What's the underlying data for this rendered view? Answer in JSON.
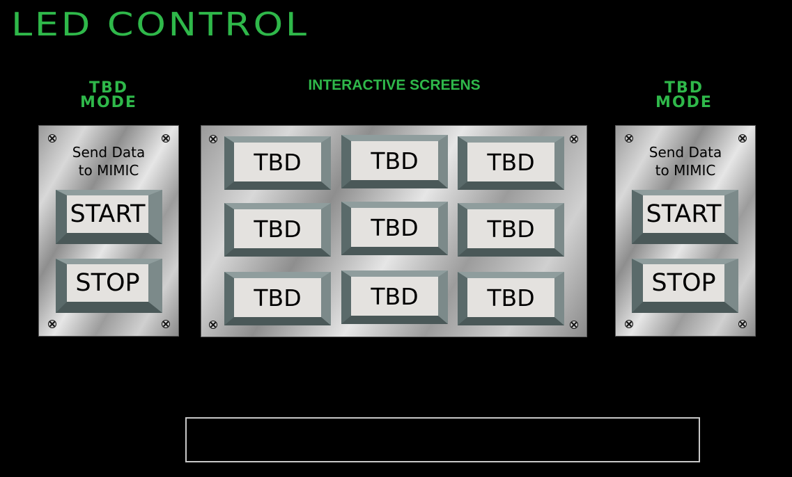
{
  "header": {
    "title": "LED CONTROL"
  },
  "left_panel": {
    "mode_label_line1": "TBD",
    "mode_label_line2": "MODE",
    "send_text_line1": "Send Data",
    "send_text_line2": "to MIMIC",
    "start_label": "START",
    "stop_label": "STOP"
  },
  "center_panel": {
    "label": "INTERACTIVE SCREENS",
    "buttons": [
      "TBD",
      "TBD",
      "TBD",
      "TBD",
      "TBD",
      "TBD",
      "TBD",
      "TBD",
      "TBD"
    ]
  },
  "right_panel": {
    "mode_label_line1": "TBD",
    "mode_label_line2": "MODE",
    "send_text_line1": "Send Data",
    "send_text_line2": "to MIMIC",
    "start_label": "START",
    "stop_label": "STOP"
  },
  "status_box": {
    "text": ""
  },
  "colors": {
    "accent": "#2fb84a",
    "background": "#000000",
    "button_face": "#e4e2df",
    "bevel": "#5a6a6a"
  },
  "icons": {
    "screw": "screw-icon"
  }
}
